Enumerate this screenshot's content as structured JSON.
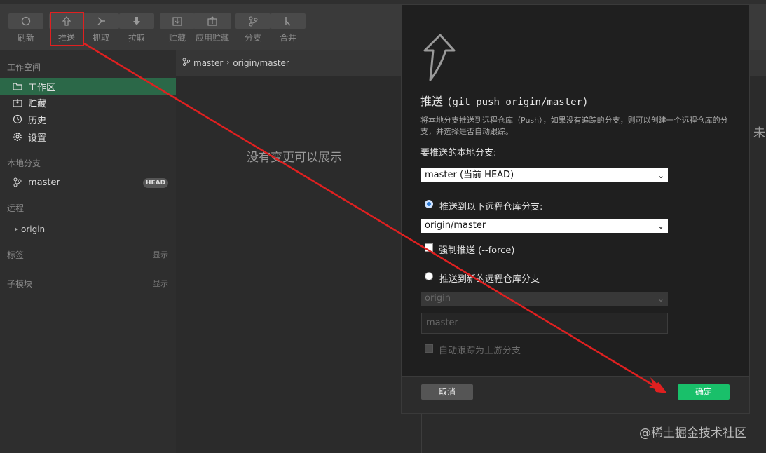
{
  "toolbar": {
    "buttons": [
      {
        "label": "刷新",
        "icon": "refresh-icon"
      },
      {
        "label": "推送",
        "icon": "push-icon"
      },
      {
        "label": "抓取",
        "icon": "fetch-icon"
      },
      {
        "label": "拉取",
        "icon": "pull-icon"
      },
      {
        "label": "贮藏",
        "icon": "stash-icon"
      },
      {
        "label": "应用贮藏",
        "icon": "apply-stash-icon"
      },
      {
        "label": "分支",
        "icon": "branch-icon"
      },
      {
        "label": "合并",
        "icon": "merge-icon"
      }
    ]
  },
  "sidebar": {
    "workspace_title": "工作空间",
    "workspace_items": [
      {
        "label": "工作区",
        "icon": "folder-icon",
        "active": true
      },
      {
        "label": "贮藏",
        "icon": "stash-icon"
      },
      {
        "label": "历史",
        "icon": "history-icon"
      },
      {
        "label": "设置",
        "icon": "settings-gear-icon"
      }
    ],
    "local_branches_title": "本地分支",
    "local_branch": {
      "label": "master",
      "badge": "HEAD",
      "icon": "branch-icon"
    },
    "remotes_title": "远程",
    "remote": {
      "label": "origin",
      "icon": "caret-right-icon"
    },
    "tags_title": "标签",
    "tags_show": "显示",
    "submodules_title": "子模块",
    "submodules_show": "显示"
  },
  "main": {
    "breadcrumb_branch": "master",
    "breadcrumb_remote": "origin/master",
    "empty_text": "没有变更可以展示",
    "clipped_text": "未"
  },
  "dialog": {
    "icon": "push-arrow-icon",
    "title_cn": "推送",
    "title_cmd": "(git push origin/master)",
    "description": "将本地分支推送到远程仓库（Push），如果没有追踪的分支，则可以创建一个远程仓库的分支，并选择是否自动跟踪。",
    "local_branch_label": "要推送的本地分支:",
    "local_branch_value": "master (当前 HEAD)",
    "radio_existing_label": "推送到以下远程仓库分支:",
    "remote_branch_value": "origin/master",
    "force_label": "强制推送 (--force)",
    "radio_new_label": "推送到新的远程仓库分支",
    "new_remote_value": "origin",
    "new_branch_value": "master",
    "auto_track_label": "自动跟踪为上游分支",
    "cancel_label": "取消",
    "ok_label": "确定"
  },
  "watermark": "@稀土掘金技术社区",
  "colors": {
    "active": "#2b6848",
    "ok": "#19c06a",
    "annotation": "#e02020"
  }
}
